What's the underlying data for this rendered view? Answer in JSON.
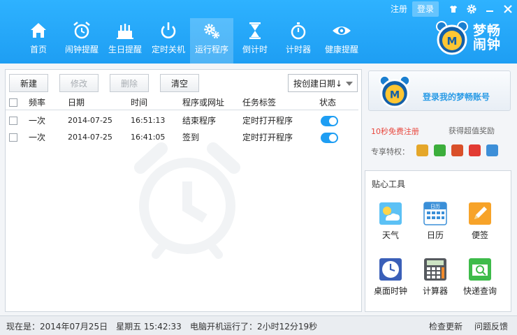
{
  "topbar": {
    "register": "注册",
    "login": "登录"
  },
  "nav": [
    {
      "label": "首页"
    },
    {
      "label": "闹钟提醒"
    },
    {
      "label": "生日提醒"
    },
    {
      "label": "定时关机"
    },
    {
      "label": "运行程序",
      "active": true
    },
    {
      "label": "倒计时"
    },
    {
      "label": "计时器"
    },
    {
      "label": "健康提醒"
    }
  ],
  "brand": {
    "line1": "梦畅",
    "line2": "闹钟"
  },
  "toolbar": {
    "new": "新建",
    "edit": "修改",
    "delete": "删除",
    "clear": "清空",
    "sort": "按创建日期↓"
  },
  "table": {
    "headers": {
      "freq": "频率",
      "date": "日期",
      "time": "时间",
      "program": "程序或网址",
      "tag": "任务标签",
      "status": "状态"
    },
    "rows": [
      {
        "freq": "一次",
        "date": "2014-07-25",
        "time": "16:51:13",
        "program": "结束程序",
        "tag": "定时打开程序",
        "on": true
      },
      {
        "freq": "一次",
        "date": "2014-07-25",
        "time": "16:41:05",
        "program": "签到",
        "tag": "定时打开程序",
        "on": true
      }
    ]
  },
  "account": {
    "login_text": "登录我的梦畅账号",
    "register_link": "10秒免费注册",
    "reward_link": "获得超值奖励",
    "vip_label": "专享特权："
  },
  "tools": {
    "title": "贴心工具",
    "calendar_icon_text": "日历",
    "items": [
      {
        "label": "天气"
      },
      {
        "label": "日历"
      },
      {
        "label": "便签"
      },
      {
        "label": "桌面时钟"
      },
      {
        "label": "计算器"
      },
      {
        "label": "快递查询"
      }
    ]
  },
  "status": {
    "now": "现在是：2014年07月25日　星期五 15:42:33",
    "uptime": "电脑开机运行了：2小时12分19秒",
    "update": "检查更新",
    "feedback": "问题反馈"
  },
  "colors": {
    "accent": "#1e9ef3",
    "register": "#e8463c",
    "login_text": "#2a9be6"
  }
}
